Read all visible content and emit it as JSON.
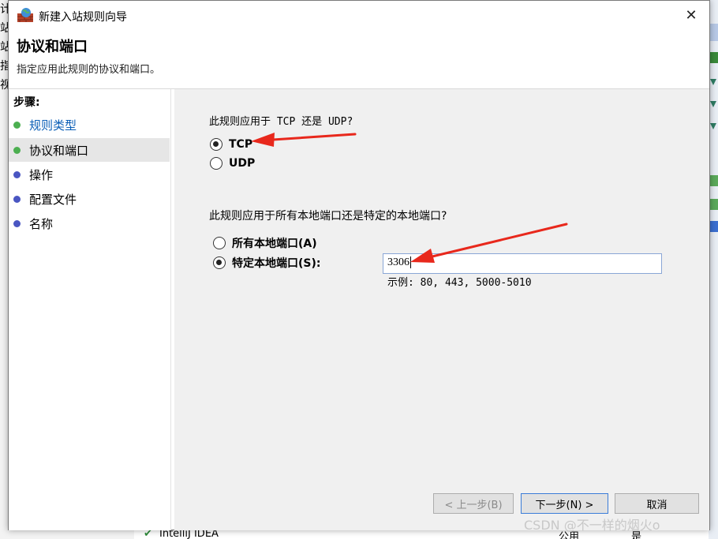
{
  "window": {
    "title": "新建入站规则向导",
    "close_glyph": "✕"
  },
  "header": {
    "title": "协议和端口",
    "subtitle": "指定应用此规则的协议和端口。"
  },
  "steps": {
    "label": "步骤:",
    "items": [
      {
        "label": "规则类型",
        "state": "done",
        "dot_color": "#4caf50"
      },
      {
        "label": "协议和端口",
        "state": "current",
        "dot_color": "#4caf50"
      },
      {
        "label": "操作",
        "state": "pending",
        "dot_color": "#4a56c2"
      },
      {
        "label": "配置文件",
        "state": "pending",
        "dot_color": "#4a56c2"
      },
      {
        "label": "名称",
        "state": "pending",
        "dot_color": "#4a56c2"
      }
    ]
  },
  "protocol": {
    "question": "此规则应用于 TCP 还是 UDP?",
    "options": [
      {
        "label": "TCP",
        "selected": true
      },
      {
        "label": "UDP",
        "selected": false
      }
    ]
  },
  "ports": {
    "question": "此规则应用于所有本地端口还是特定的本地端口?",
    "options": [
      {
        "label": "所有本地端口(A)",
        "selected": false
      },
      {
        "label": "特定本地端口(S):",
        "selected": true
      }
    ],
    "value": "3306",
    "example": "示例: 80, 443, 5000-5010"
  },
  "buttons": {
    "back": "< 上一步(B)",
    "next": "下一步(N) >",
    "cancel": "取消"
  },
  "background": {
    "left_glyphs": [
      "计",
      "站",
      "站",
      "指",
      "视"
    ],
    "bottom_app": "IntelliJ IDEA",
    "bottom_profile": "公用",
    "bottom_enabled": "是"
  },
  "watermark": "CSDN @不一样的烟火o",
  "colors": {
    "accent": "#0b5fb7",
    "arrow": "#e8281c",
    "done_dot": "#4caf50",
    "pending_dot": "#4a56c2"
  }
}
